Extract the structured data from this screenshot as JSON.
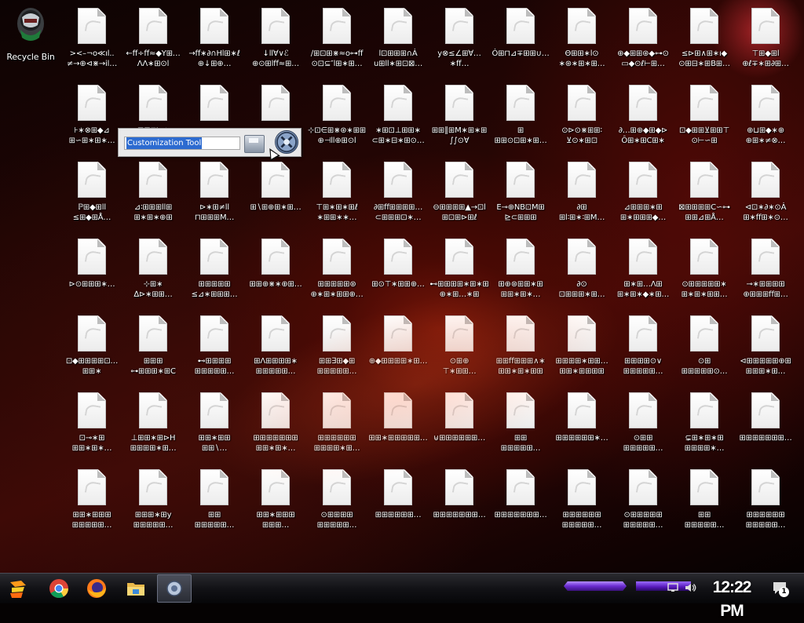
{
  "desktop": {
    "recycle_bin_label": "Recycle Bin",
    "rename_box": {
      "value": "Customization Tool"
    },
    "icons": [
      [
        "><–¬o≪ıl..\n≠→⊕⊲⋇→il…",
        "←ff÷ff≈◆Y⊞…\nΛΛ∗⊞⊙l",
        "→ff∗∂∩Hl⊞∗ℓ\n⊕↓⊞⊕…",
        "↓ll∀∨ℰ\n⊕⊙⊞lff≈⊞…",
        "∕⊞⊡⊞⋇≈o⊶ff\n⊙⊡⊆″l⊞∗⊞…",
        "l⊡⊞⊞⊞∩Ȧ\nu⊞ll∗⊞⊡⊠…",
        "y⊗≤∠⊞∀…∗ff…",
        "Ȯ⊞⊓⊿∓⊞⊞∪…",
        "Θ⊞⊞∗l⊙\n∗⊛∗⊞∗⊞…",
        "⊕◆⊞⊞⊛◆⊶⊙\n▭◆⊙ℓ⊢⊞…",
        "≤⊳⊞∧⊞∗ı◆\n⊙⊞⊟∗⊞B⊞…",
        "⊤⊞◆⊞l\n⊕ℓ∓∗⊞∂⊞…"
      ],
      [
        "⊦∗⊗⊞◆⊿\n⊞∽⊞∗⊞∗…",
        "⊞⊞⊓⊢◆\n↑⊿⊞∕⊞⊕…",
        "",
        "",
        "⊹⊡∈⊞⋇⊛∗⊞⊞\n⊕⊣ll⊕⊞⊙l",
        "∗⊞⊡⊥⊞⊞∗\n⊂⊞∗⊟∗⊞⊙…",
        "⊞⊞∥⊞M∗⊞∗⊞\n∫∫⊙∀",
        "⊞\n⊞⊞⊙⊡⊞∗⊞…",
        "⊙⊳⊙⋇⊞⊞∶\n⊻⊙∗⊞⊡",
        "∂…⊞⊕◆⊞◆⊳\nÔ⊞∗⊞C⊞∗",
        "⊡◆⊞⊞⊻⊞⊞⊤\n⊙⊢∽⊞",
        "⊕⊔⊞◆∗⊕\n⊕⊞∗≠⊗…"
      ],
      [
        "ℙ⊞◆⊞ll\n≤⊞◆⊞Å…",
        "⊿∶⊞⊞⊞ll⊞\n⊞∗⊞∗⊕⊞",
        "⊳∗⊞≠ll\n⊓⊞⊞⊞M…",
        "⊞∖⊞⊕⊞∗⊞…\n",
        "⊤⊞∗⊞∗⊞ℓ\n∗⊞⊞∗∗…",
        "∂⊞ff⊞⊞⊞⊞…\n⊂⊞⊞⊞⊡∗…",
        "⊖⊞⊞⊞⊞▲→⊡l\n⊞⊡⊞⊳⊞ℓ",
        "E⊸⊕NB⊡M⊞\n⊵⊂⊞⊞⊞",
        "∂⊞\n⊞l∶⊞∗∶⊞M…",
        "⊿⊞⊞⊞∗⊞\n⊞∗⊞⊞⊞◆…",
        "⊠⊞⊞⊞⊞C∽⊶\n⊞⊞⊿⊞Å…",
        "⊲⊡∗∂∗⊙Ȧ\n⊞∗ff⊞∗⊙…"
      ],
      [
        "⊳⊙⊞⊞⊞∗…",
        "⊹⊞∗\n∆⊳∗⊞⊞…",
        "⊞⊞⊞⊞⊞\n≤⊿∗⊞⊞⊞…",
        "⊞⊞⊕⋇∗⊕⊞…",
        "⊞⊞⊞⊞⊞⊛\n⊕∗⊞∗⊞⊞⊕…",
        "⊞⊙⊤∗⊞⊞⊕…",
        "⊷⊞⊞⊞⊞∗⊞∗⊞\n⊕∗⊞…∗⊞",
        "⊞⊕⊛⊞⊞∗⊞\n⊞⊞∗⊞∗…",
        "∂⊙\n⊡⊞⊞⊞∗⊞…",
        "⊞∗⊞…Λ⊞\n⊞∗⊞∗◆∗⊞…",
        "⊙⊞⊞⊞⊞⊞∗\n⊞∗⊞∗⊞⊞…",
        "⊸∗⊞⊞⊞⊞\n⊕⊞⊞⊞ff⊞…"
      ],
      [
        "⊡◆⊞⊞⊞⊞⊡…\n⊞⊞∗",
        "⊞⊞⊞\n⊶⊞⊞⊞∗⊞C",
        "⊷⊞⊞⊞⊞\n⊞⊞⊞⊞⊞…",
        "⊞Λ⊞⊞⊞⊞∗\n⊞⊞⊞⊞⊞…",
        "⊞⊞∃⊞◆⊞\n⊞⊞⊞⊞⊞…",
        "⊕◆⊞⊞⊞⊞∗⊞…",
        "⊙⊞⊕\n⊤∗⊞⊞…",
        "⊞⊞ff⊞⊞⊞∧∗\n⊞⊞∗⊞∗⊞⊞",
        "⊞⊞⊞⊞∗⊞⊞…\n⊞⊞∗⊞⊞⊞⊞",
        "⊞⊞⊞⊞⊙∨\n⊞⊞⊞⊞⊞…",
        "⊙⊞\n⊞⊞⊞⊞⊞⊙…",
        "⊲⊞⊞⊞⊞⊞⊕⊞\n⊞⊞⊞∗⊞…"
      ],
      [
        "⊡⊸∗⊞\n⊞⊞∗⊞∗…",
        "⊥⊞⊞∗⊞⊳H\n⊞⊞⊞⊞∗⊞…",
        "⊞⊞∗⊞⊞\n⊞⊞∖…",
        "⊞⊞⊞⊞⊞⊞⊞\n⊞⊞∗⊞∗…",
        "⊞⊞⊞⊞⊞⊞\n⊞⊞⊞⊞∗⊞…",
        "⊞⊞∗⊞⊞⊞⊞⊞…",
        "⊎⊞⊞⊞⊞⊞⊞…",
        "⊞⊞\n⊞⊞⊞⊞⊞…",
        "⊞⊞⊞⊞⊞⊞∗…",
        "⊙⊞⊞\n⊞⊞⊞⊞⊞…",
        "⊊⊞∗⊞∗⊞\n⊞⊞⊞⊞∗…",
        "⊞⊞⊞⊞⊞⊞⊞…",
        "⊂⊞⊞⊞⊞⊞\n⊞⊞⊞⊞∗…",
        "⊞⊞⊞⊞⊞⊞⊞…"
      ],
      [
        "⊞⊞∗⊞⊞⊞\n⊞⊞⊞⊞⊞…",
        "⊞⊞⊞∗⊞y\n⊞⊞⊞⊞⊞…",
        "⊞⊞\n⊞⊞⊞⊞⊞…",
        "⊞⊞∗⊞⊞⊞\n⊞⊞⊞…",
        "⊙⊞⊞⊞⊞\n⊞⊞⊞⊞⊞…",
        "⊞⊞⊞⊞⊞⊞…",
        "⊞⊞⊞⊞⊞⊞⊞…",
        "⊞⊞⊞⊞⊞⊞⊞…",
        "⊞⊞⊞⊞⊞⊞\n⊞⊞⊞⊞⊞…",
        "⊙⊞⊞⊞⊞⊞\n⊞⊞⊞⊞⊞…",
        "⊞⊞\n⊞⊞⊞⊞⊞…",
        "⊞⊞⊞⊞⊞⊞\n⊞⊞⊞⊞⊞…",
        "⊞⊞⊞⊞⊞⊞\n⊞⊞⊞⊞⊞…"
      ]
    ]
  },
  "taskbar": {
    "clock": "12:22 PM",
    "notification_count": "1"
  },
  "colors": {
    "selection": "#2d6bd0",
    "taskbar_accent": "#7a3cf0"
  }
}
